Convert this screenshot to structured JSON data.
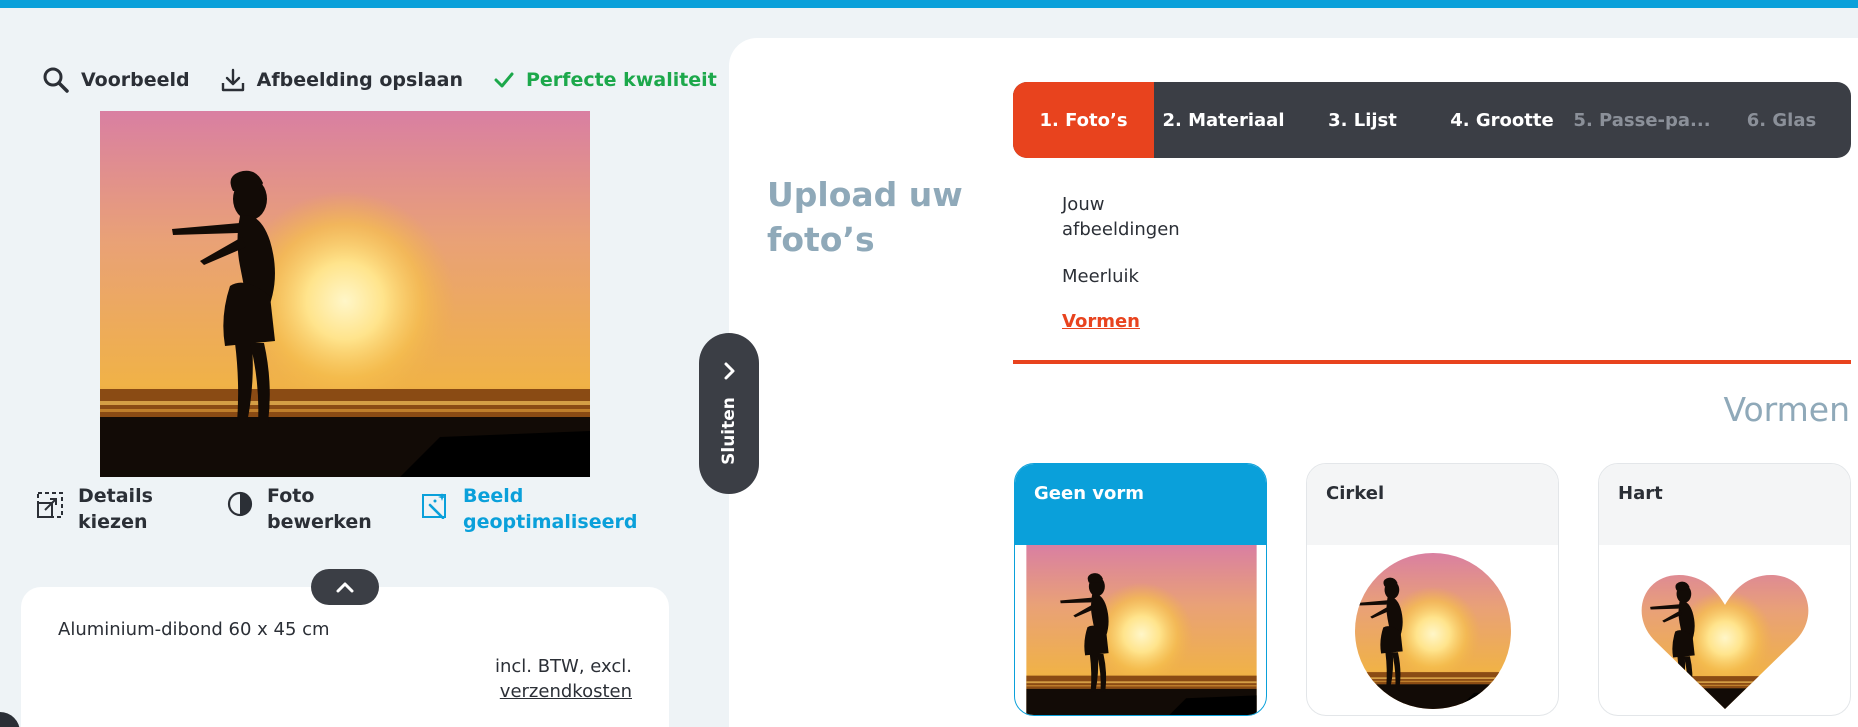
{
  "toolbar": {
    "preview_label": "Voorbeeld",
    "save_label": "Afbeelding opslaan",
    "quality_label": "Perfecte kwaliteit"
  },
  "actions": {
    "details_label": "Details kiezen",
    "edit_label": "Foto bewerken",
    "optimized_label": "Beeld geoptimaliseerd"
  },
  "summary": {
    "product": "Aluminium-dibond 60 x 45 cm",
    "tax_line": "incl. BTW, excl.",
    "shipping_link": "verzendkosten"
  },
  "close_tab": {
    "label": "Sluiten"
  },
  "upload": {
    "title": "Upload uw foto’s"
  },
  "steps": [
    {
      "label": "1. Foto’s",
      "state": "active"
    },
    {
      "label": "2. Materiaal",
      "state": "enabled"
    },
    {
      "label": "3. Lijst",
      "state": "enabled"
    },
    {
      "label": "4. Grootte",
      "state": "enabled"
    },
    {
      "label": "5. Passe-pa...",
      "state": "disabled"
    },
    {
      "label": "6. Glas",
      "state": "disabled"
    }
  ],
  "submenu": [
    {
      "label": "Jouw afbeeldingen",
      "active": false
    },
    {
      "label": "Meerluik",
      "active": false
    },
    {
      "label": "Vormen",
      "active": true
    }
  ],
  "section": {
    "title": "Vormen"
  },
  "shapes": [
    {
      "label": "Geen vorm",
      "selected": true
    },
    {
      "label": "Cirkel",
      "selected": false
    },
    {
      "label": "Hart",
      "selected": false
    }
  ],
  "colors": {
    "accent": "#e8431e",
    "brand_blue": "#0aa0da",
    "dark": "#3b3e45",
    "quality_green": "#1ca84b"
  }
}
